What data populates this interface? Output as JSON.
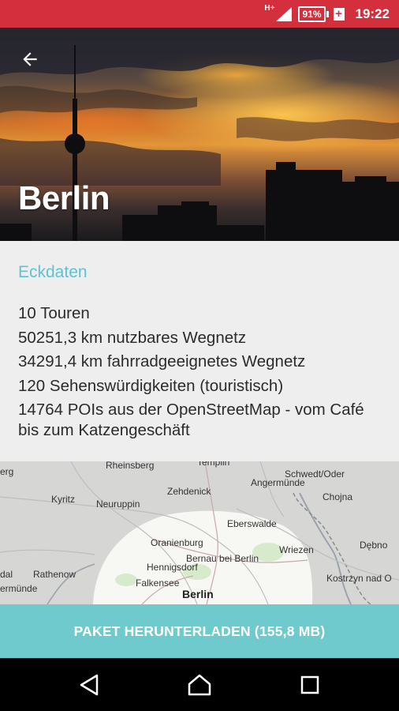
{
  "status_bar": {
    "network": "H+",
    "battery": "91%",
    "time": "19:22",
    "color": "#d32f3c"
  },
  "header": {
    "title": "Berlin",
    "back_icon": "arrow-left-icon"
  },
  "info": {
    "section_title": "Eckdaten",
    "facts": [
      "10 Touren",
      "50251,3 km nutzbares Wegnetz",
      "34291,4 km fahrradgeeignetes Wegnetz",
      "120 Sehenswürdigkeiten (touristisch)",
      "14764 POIs aus der OpenStreetMap - vom Café bis zum Katzengeschäft"
    ],
    "accent_color": "#5ec3d1"
  },
  "map": {
    "labels": {
      "rheinsberg": "Rheinsberg",
      "templin": "Templin",
      "berg": "erg",
      "schwedt": "Schwedt/Oder",
      "angermuende": "Angermünde",
      "kyritz": "Kyritz",
      "neuruppin": "Neuruppin",
      "zehdenick": "Zehdenick",
      "chojna": "Chojna",
      "eberswalde": "Eberswalde",
      "oranienburg": "Oranienburg",
      "debno": "Dębno",
      "wriezen": "Wriezen",
      "bernau": "Bernau bei Berlin",
      "hennigsdorf": "Hennigsdorf",
      "rathenow": "Rathenow",
      "dal": "dal",
      "kostrzyn": "Kostrzyn nad O",
      "falkensee": "Falkensee",
      "ermuende": "ermünde",
      "berlin": "Berlin"
    }
  },
  "download_button": {
    "label": "PAKET HERUNTERLADEN (155,8 MB)",
    "color": "#6ecacd"
  },
  "nav_bar": {
    "back_icon": "triangle-back-icon",
    "home_icon": "circle-home-icon",
    "recents_icon": "square-recents-icon"
  }
}
